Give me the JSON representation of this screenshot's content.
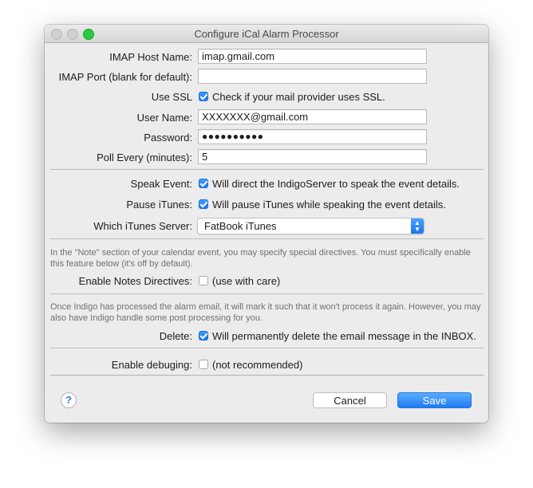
{
  "window": {
    "title": "Configure iCal Alarm Processor"
  },
  "imap_host": {
    "label": "IMAP Host Name:",
    "value": "imap.gmail.com"
  },
  "imap_port": {
    "label": "IMAP Port (blank for default):",
    "value": ""
  },
  "use_ssl": {
    "label": "Use SSL",
    "checked": true,
    "text": "Check if your mail provider uses SSL."
  },
  "user_name": {
    "label": "User Name:",
    "value": "XXXXXXX@gmail.com"
  },
  "password": {
    "label": "Password:",
    "value": "●●●●●●●●●●"
  },
  "poll_every": {
    "label": "Poll Every (minutes):",
    "value": "5"
  },
  "speak_event": {
    "label": "Speak Event:",
    "checked": true,
    "text": "Will direct the IndigoServer to speak the event details."
  },
  "pause_itunes": {
    "label": "Pause iTunes:",
    "checked": true,
    "text": "Will pause iTunes while speaking the event details."
  },
  "itunes_server": {
    "label": "Which iTunes Server:",
    "selected": "FatBook iTunes"
  },
  "notes_help": "In the \"Note\" section of your calendar event, you may specify special directives. You must specifically enable this feature below (it's off by default).",
  "notes_directives": {
    "label": "Enable Notes Directives:",
    "checked": false,
    "text": "(use with care)"
  },
  "delete_help": "Once Indigo has processed the alarm email, it will mark it such that it won't process it again. However, you may also have Indigo handle some post processing for you.",
  "delete": {
    "label": "Delete:",
    "checked": true,
    "text": "Will permanently delete the email message in the INBOX."
  },
  "debugging": {
    "label": "Enable debuging:",
    "checked": false,
    "text": "(not recommended)"
  },
  "buttons": {
    "help": "?",
    "cancel": "Cancel",
    "save": "Save"
  },
  "select_arrows": {
    "up": "▲",
    "down": "▼"
  },
  "colors": {
    "accent": "#1f7bf2",
    "window_bg": "#ececec",
    "zoom_button": "#28c940"
  }
}
